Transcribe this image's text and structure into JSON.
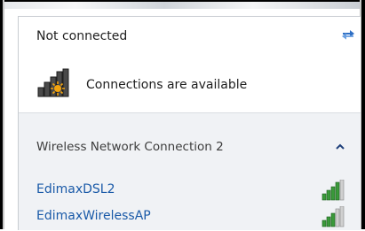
{
  "status": {
    "title": "Not connected",
    "availability": "Connections are available"
  },
  "icons": {
    "refresh": "refresh-arrows-icon",
    "availability": "network-signal-sun-icon",
    "collapse": "chevron-up-icon",
    "signal": "wifi-signal-bars-icon"
  },
  "section": {
    "title": "Wireless Network Connection 2"
  },
  "networks": [
    {
      "name": "EdimaxDSL2",
      "signal_bars": 4
    },
    {
      "name": "EdimaxWirelessAP",
      "signal_bars": 3
    }
  ],
  "colors": {
    "link": "#1a5aa8",
    "section_bg": "#f0f2f5",
    "signal_green": "#3a9a3a"
  }
}
